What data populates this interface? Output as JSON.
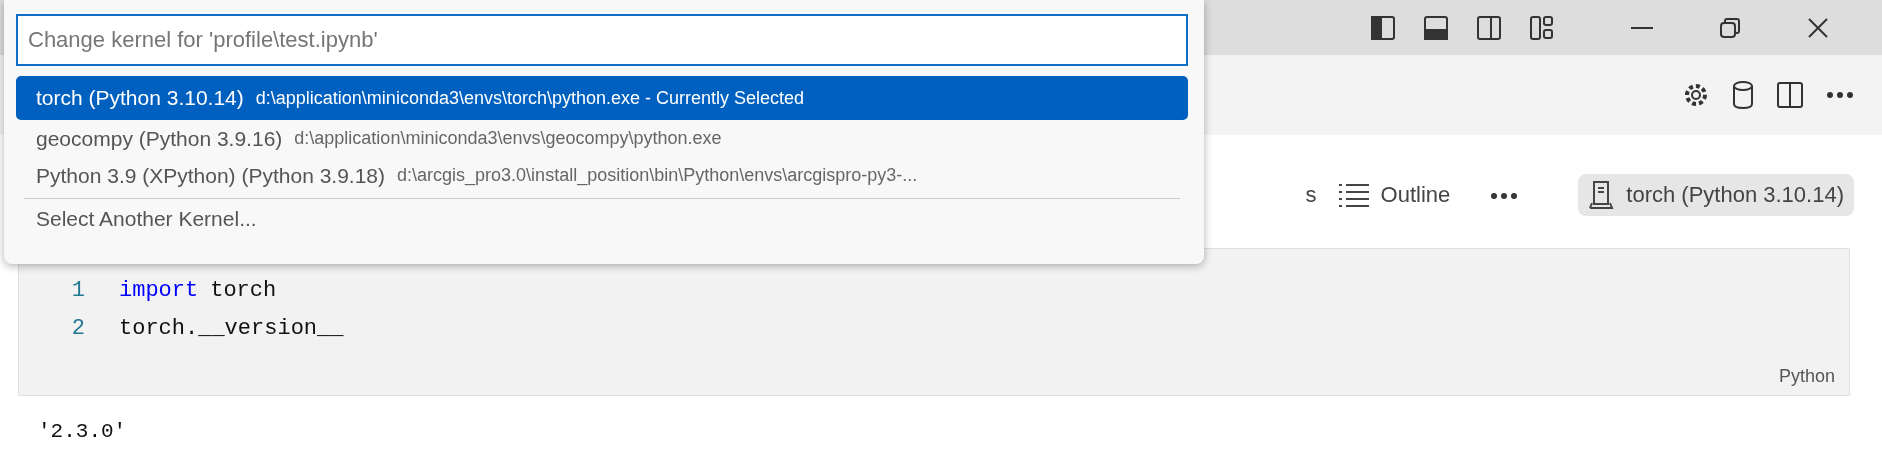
{
  "kernel_picker": {
    "placeholder": "Change kernel for 'profile\\test.ipynb'",
    "items": [
      {
        "name": "torch (Python 3.10.14)",
        "detail": "d:\\application\\miniconda3\\envs\\torch\\python.exe - Currently Selected",
        "selected": true
      },
      {
        "name": "geocompy (Python 3.9.16)",
        "detail": "d:\\application\\miniconda3\\envs\\geocompy\\python.exe",
        "selected": false
      },
      {
        "name": "Python 3.9 (XPython) (Python 3.9.18)",
        "detail": "d:\\arcgis_pro3.0\\install_position\\bin\\Python\\envs\\arcgispro-py3-...",
        "selected": false
      }
    ],
    "action": "Select Another Kernel..."
  },
  "notebook_toolbar": {
    "partial_label": "s",
    "outline": "Outline",
    "kernel": "torch (Python 3.10.14)"
  },
  "cell": {
    "lines": [
      {
        "number": "1",
        "tokens": [
          {
            "text": "import",
            "kind": "keyword"
          },
          {
            "text": "torch",
            "kind": "plain"
          }
        ]
      },
      {
        "number": "2",
        "tokens": [
          {
            "text": "torch.__version__",
            "kind": "plain"
          }
        ]
      }
    ],
    "language": "Python"
  },
  "output": "'2.3.0'"
}
